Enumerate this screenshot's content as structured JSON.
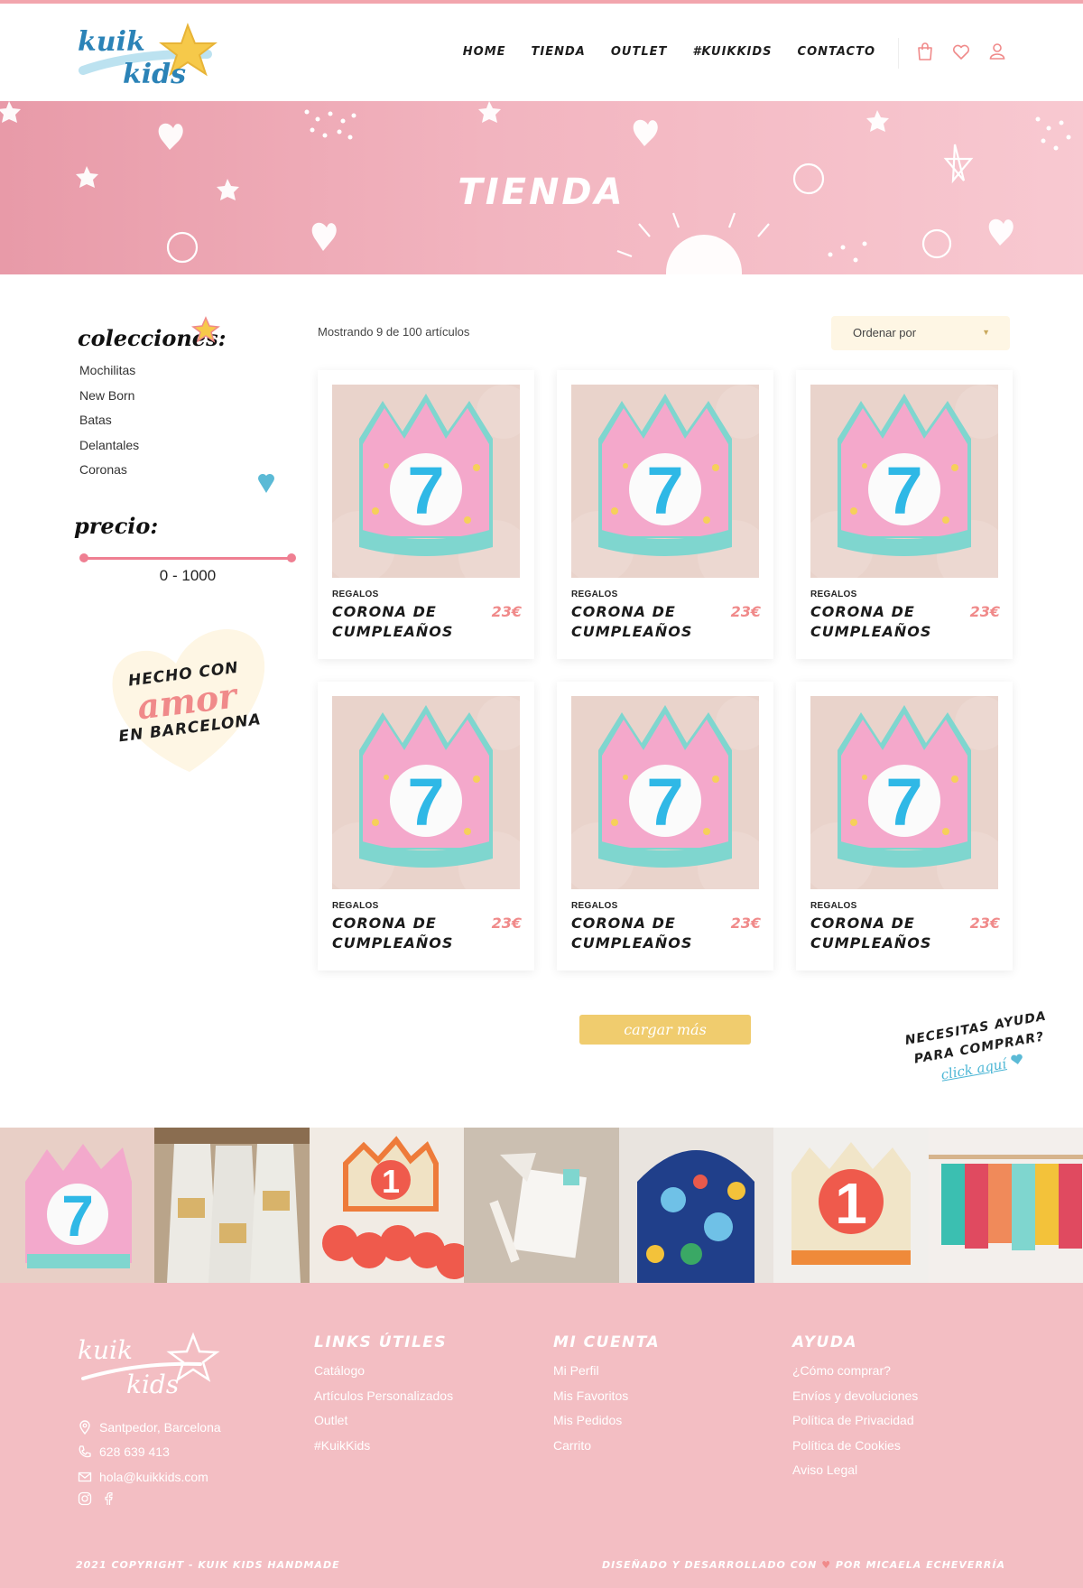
{
  "header": {
    "logo_alt": "kuik kids",
    "nav": [
      {
        "label": "HOME",
        "active": false
      },
      {
        "label": "TIENDA",
        "active": true
      },
      {
        "label": "OUTLET",
        "active": false
      },
      {
        "label": "#KUIKKIDS",
        "active": false
      },
      {
        "label": "CONTACTO",
        "active": false
      }
    ],
    "icons": [
      "bag-icon",
      "heart-icon",
      "user-icon"
    ]
  },
  "banner": {
    "title": "TIENDA"
  },
  "sidebar": {
    "collections_heading": "colecciones:",
    "collections": [
      "Mochilitas",
      "New Born",
      "Batas",
      "Delantales",
      "Coronas"
    ],
    "price_heading": "precio:",
    "price_range": "0 - 1000",
    "price_min": 0,
    "price_max": 1000,
    "badge": {
      "line1": "HECHO CON",
      "line2": "amor",
      "line3": "EN BARCELONA"
    }
  },
  "listing": {
    "showing": "Mostrando 9 de 100 artículos",
    "sort_label": "Ordenar por",
    "products": [
      {
        "category": "REGALOS",
        "name": "CORONA DE CUMPLEAÑOS",
        "price": "23€"
      },
      {
        "category": "REGALOS",
        "name": "CORONA DE CUMPLEAÑOS",
        "price": "23€"
      },
      {
        "category": "REGALOS",
        "name": "CORONA DE CUMPLEAÑOS",
        "price": "23€"
      },
      {
        "category": "REGALOS",
        "name": "CORONA DE CUMPLEAÑOS",
        "price": "23€"
      },
      {
        "category": "REGALOS",
        "name": "CORONA DE CUMPLEAÑOS",
        "price": "23€"
      },
      {
        "category": "REGALOS",
        "name": "CORONA DE CUMPLEAÑOS",
        "price": "23€"
      }
    ],
    "load_more": "cargar más",
    "help": {
      "line1": "NECESITAS AYUDA",
      "line2": "PARA COMPRAR?",
      "link": "click aquí"
    }
  },
  "footer": {
    "contact": {
      "address": "Santpedor, Barcelona",
      "phone": "628 639 413",
      "email": "hola@kuikkids.com"
    },
    "columns": [
      {
        "title": "LINKS ÚTILES",
        "links": [
          "Catálogo",
          "Artículos Personalizados",
          "Outlet",
          "#KuikKids"
        ]
      },
      {
        "title": "MI CUENTA",
        "links": [
          "Mi Perfil",
          "Mis Favoritos",
          "Mis Pedidos",
          "Carrito"
        ]
      },
      {
        "title": "AYUDA",
        "links": [
          "¿Cómo comprar?",
          "Envíos y devoluciones",
          "Política de Privacidad",
          "Política de Cookies",
          "Aviso Legal"
        ]
      }
    ],
    "copyright": "2021 COPYRIGHT - KUIK KIDS HANDMADE",
    "credits_pre": "DISEÑADO Y DESARROLLADO CON",
    "credits_post": "POR MICAELA ECHEVERRÍA"
  },
  "colors": {
    "accent_pink": "#f08a8a",
    "banner_pink": "#f2b4bf",
    "footer_pink": "#f3bec3",
    "button_yellow": "#f0cc6e",
    "accent_blue": "#4bb6d5"
  }
}
